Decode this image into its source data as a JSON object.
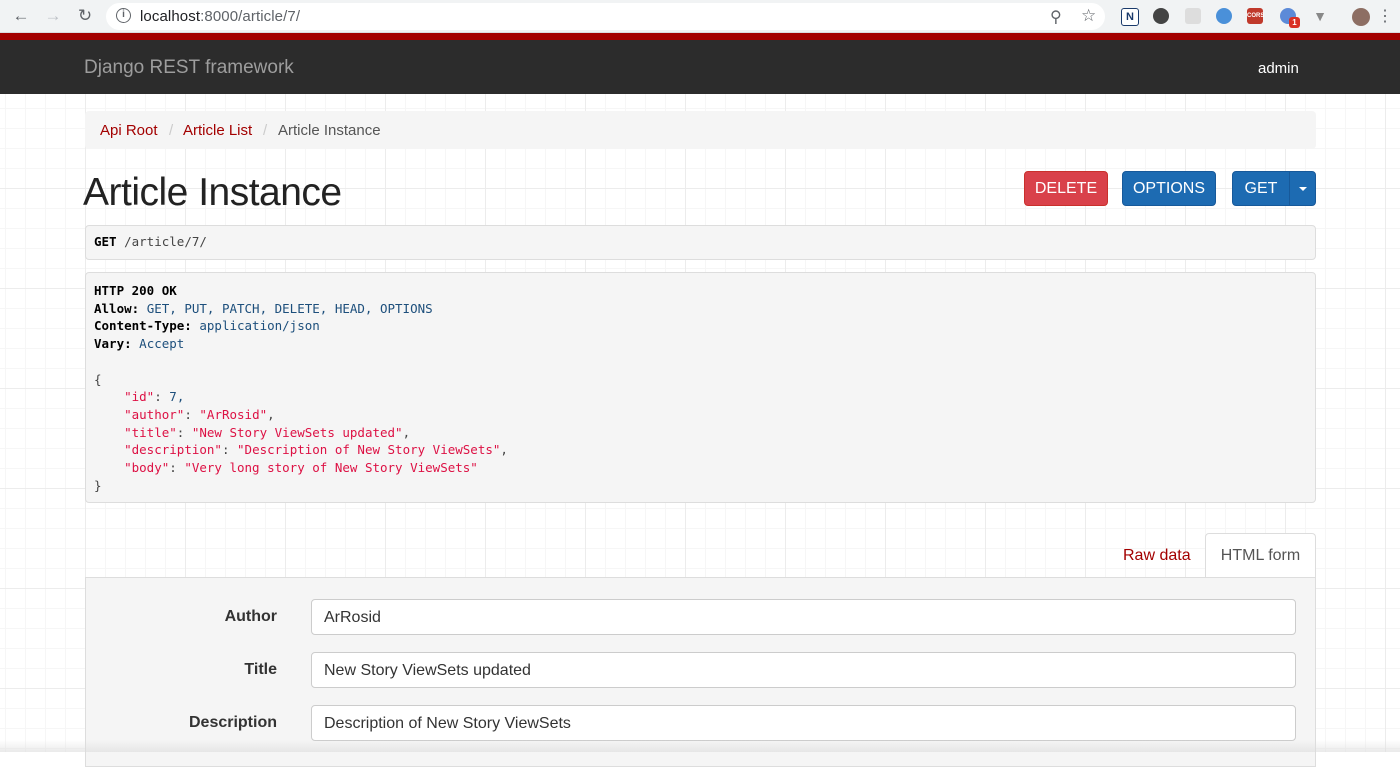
{
  "browser": {
    "url_host": "localhost",
    "url_rest": ":8000/article/7/",
    "extension_badge": "1",
    "cors_label": "CORS"
  },
  "navbar": {
    "brand": "Django REST framework",
    "user": "admin"
  },
  "breadcrumb": {
    "items": [
      "Api Root",
      "Article List",
      "Article Instance"
    ]
  },
  "page": {
    "title": "Article Instance"
  },
  "buttons": {
    "delete": "DELETE",
    "options": "OPTIONS",
    "get": "GET"
  },
  "request": {
    "method": "GET",
    "path": "/article/7/"
  },
  "response": {
    "status": "HTTP 200 OK",
    "allow_label": "Allow:",
    "allow": "GET, PUT, PATCH, DELETE, HEAD, OPTIONS",
    "content_type_label": "Content-Type:",
    "content_type": "application/json",
    "vary_label": "Vary:",
    "vary": "Accept",
    "json": [
      {
        "key": "\"id\"",
        "value": "7",
        "type": "num",
        "comma": ","
      },
      {
        "key": "\"author\"",
        "value": "\"ArRosid\"",
        "type": "str",
        "comma": ","
      },
      {
        "key": "\"title\"",
        "value": "\"New Story ViewSets updated\"",
        "type": "str",
        "comma": ","
      },
      {
        "key": "\"description\"",
        "value": "\"Description of New Story ViewSets\"",
        "type": "str",
        "comma": ","
      },
      {
        "key": "\"body\"",
        "value": "\"Very long story of New Story ViewSets\"",
        "type": "str",
        "comma": ""
      }
    ]
  },
  "tabs": {
    "raw": "Raw data",
    "html": "HTML form"
  },
  "form": {
    "fields": [
      {
        "label": "Author",
        "value": "ArRosid"
      },
      {
        "label": "Title",
        "value": "New Story ViewSets updated"
      },
      {
        "label": "Description",
        "value": "Description of New Story ViewSets"
      }
    ]
  },
  "colors": {
    "accent": "#a30000",
    "navbar": "#2c2c2c",
    "delete": "#d9414a",
    "primary": "#1d6bb2"
  }
}
